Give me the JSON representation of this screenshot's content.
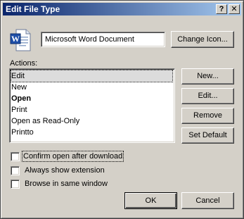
{
  "window": {
    "title": "Edit File Type",
    "help_button": "?",
    "close_button": "✕"
  },
  "file_type": {
    "icon": "word-document-icon",
    "name_value": "Microsoft Word Document",
    "change_icon_label": "Change Icon..."
  },
  "actions": {
    "label": "Actions:",
    "items": [
      {
        "label": "Edit",
        "selected": true,
        "bold": false
      },
      {
        "label": "New",
        "selected": false,
        "bold": false
      },
      {
        "label": "Open",
        "selected": false,
        "bold": true
      },
      {
        "label": "Print",
        "selected": false,
        "bold": false
      },
      {
        "label": "Open as Read-Only",
        "selected": false,
        "bold": false
      },
      {
        "label": "Printto",
        "selected": false,
        "bold": false
      }
    ],
    "buttons": {
      "new": "New...",
      "edit": "Edit...",
      "remove": "Remove",
      "set_default": "Set Default"
    }
  },
  "options": {
    "confirm_open": {
      "label": "Confirm open after download",
      "checked": false
    },
    "always_show_ext": {
      "label": "Always show extension",
      "checked": false
    },
    "browse_same_window": {
      "label": "Browse in same window",
      "checked": false
    }
  },
  "footer": {
    "ok": "OK",
    "cancel": "Cancel"
  },
  "colors": {
    "title_gradient_start": "#0a246a",
    "title_gradient_end": "#a6caf0",
    "face": "#d4d0c8"
  }
}
